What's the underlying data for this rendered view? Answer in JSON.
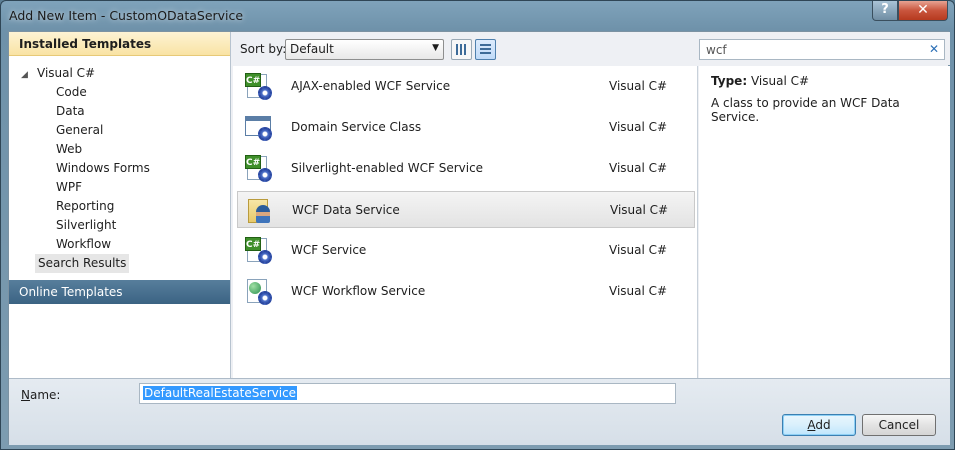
{
  "window": {
    "title": "Add New Item - CustomODataService",
    "help_label": "?",
    "close_label": "✕"
  },
  "sidebar": {
    "installed_header": "Installed Templates",
    "root_label": "Visual C#",
    "items": [
      {
        "label": "Code"
      },
      {
        "label": "Data"
      },
      {
        "label": "General"
      },
      {
        "label": "Web"
      },
      {
        "label": "Windows Forms"
      },
      {
        "label": "WPF"
      },
      {
        "label": "Reporting"
      },
      {
        "label": "Silverlight"
      },
      {
        "label": "Workflow"
      }
    ],
    "search_results_label": "Search Results",
    "online_header": "Online Templates"
  },
  "toolbar": {
    "sort_label": "Sort by:",
    "sort_value": "Default",
    "search_value": "wcf",
    "search_clear": "✕"
  },
  "templates": [
    {
      "name": "AJAX-enabled WCF Service",
      "lang": "Visual C#",
      "icon": "cs-gear-icon"
    },
    {
      "name": "Domain Service Class",
      "lang": "Visual C#",
      "icon": "window-gear-icon"
    },
    {
      "name": "Silverlight-enabled WCF Service",
      "lang": "Visual C#",
      "icon": "cs-gear-icon"
    },
    {
      "name": "WCF Data Service",
      "lang": "Visual C#",
      "icon": "data-service-icon",
      "selected": true
    },
    {
      "name": "WCF Service",
      "lang": "Visual C#",
      "icon": "cs-gear-icon"
    },
    {
      "name": "WCF Workflow Service",
      "lang": "Visual C#",
      "icon": "workflow-gear-icon"
    }
  ],
  "details": {
    "type_label": "Type:",
    "type_value": "Visual C#",
    "description": "A class to provide an WCF Data Service."
  },
  "bottom": {
    "name_label_prefix": "",
    "name_label_underlined": "N",
    "name_label_rest": "ame:",
    "name_value": "DefaultRealEstateService",
    "add_underlined": "A",
    "add_rest": "dd",
    "cancel_label": "Cancel"
  }
}
